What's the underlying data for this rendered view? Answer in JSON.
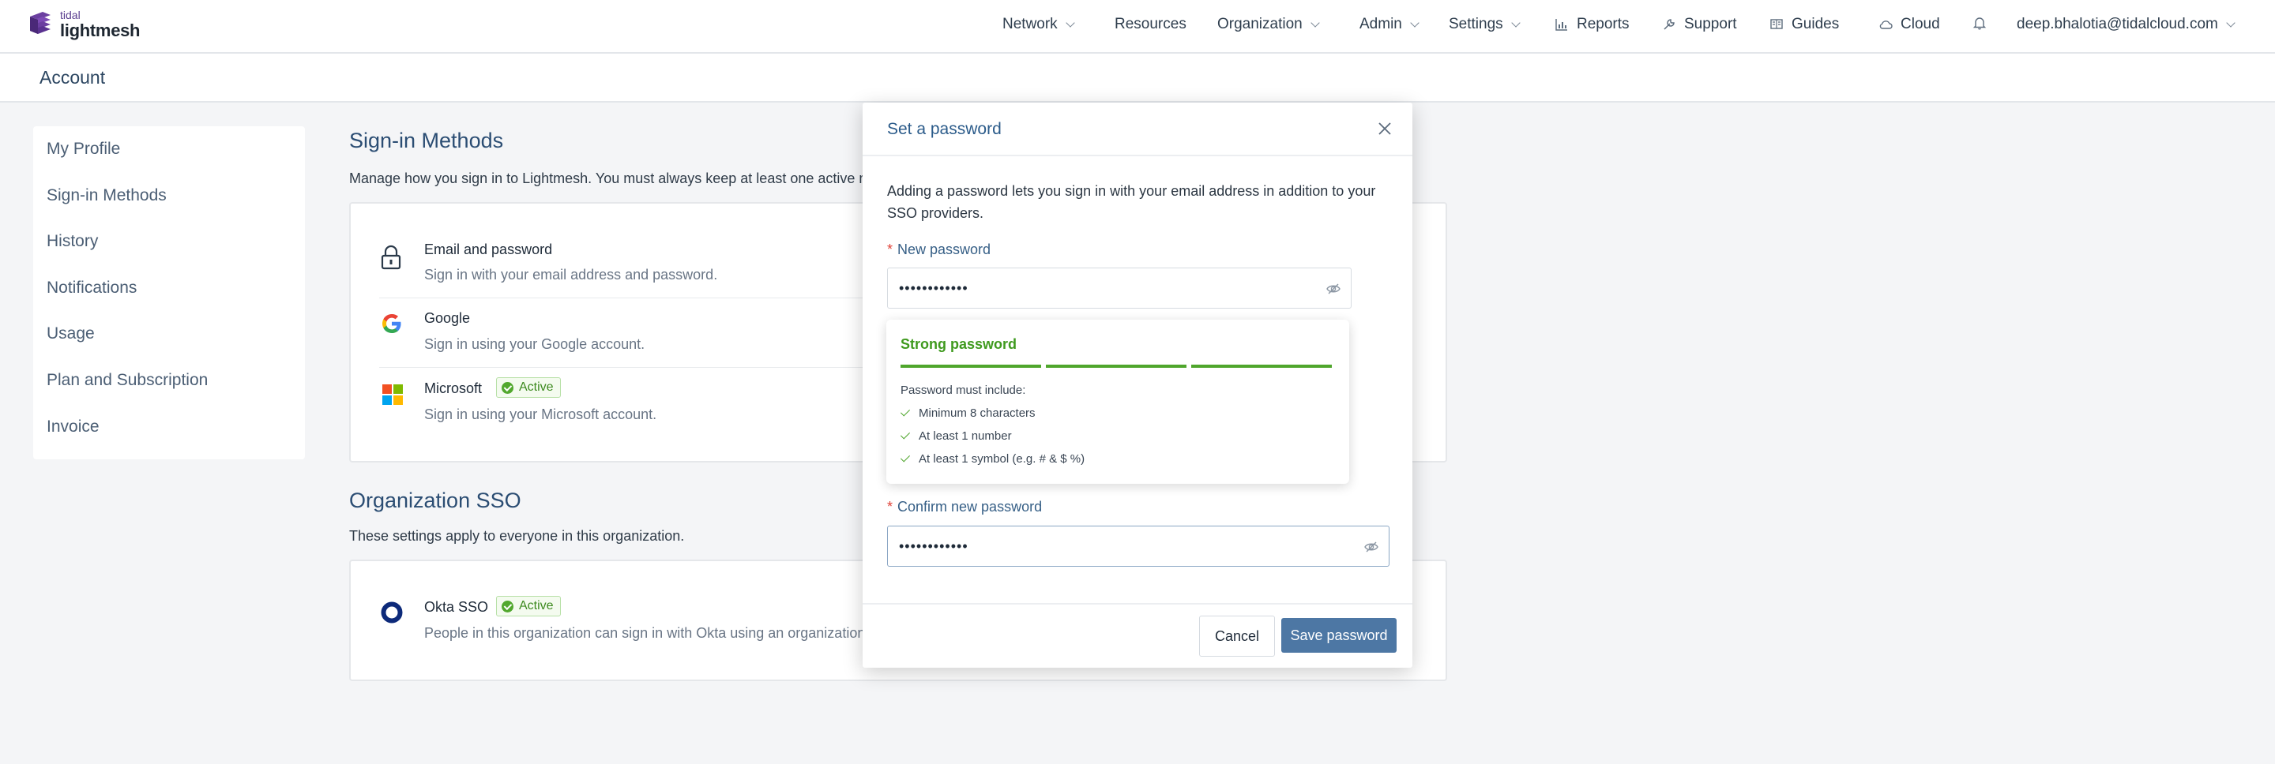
{
  "brand": {
    "small": "tidal",
    "name": "lightmesh"
  },
  "nav": {
    "network": "Network",
    "resources": "Resources",
    "organization": "Organization",
    "admin": "Admin",
    "settings": "Settings",
    "reports": "Reports",
    "support": "Support",
    "guides": "Guides",
    "cloud": "Cloud",
    "user": "deep.bhalotia@tidalcloud.com"
  },
  "page": {
    "title": "Account"
  },
  "sidebar": {
    "items": [
      {
        "label": "My Profile"
      },
      {
        "label": "Sign-in Methods"
      },
      {
        "label": "History"
      },
      {
        "label": "Notifications"
      },
      {
        "label": "Usage"
      },
      {
        "label": "Plan and Subscription"
      },
      {
        "label": "Invoice"
      }
    ]
  },
  "signin": {
    "heading": "Sign-in Methods",
    "description": "Manage how you sign in to Lightmesh. You must always keep at least one active m",
    "methods": [
      {
        "title": "Email and password",
        "subtitle": "Sign in with your email address and password.",
        "icon": "lock-icon"
      },
      {
        "title": "Google",
        "subtitle": "Sign in using your Google account.",
        "icon": "google-icon"
      },
      {
        "title": "Microsoft",
        "subtitle": "Sign in using your Microsoft account.",
        "icon": "microsoft-icon",
        "badge": "Active"
      }
    ]
  },
  "sso": {
    "heading": "Organization SSO",
    "description": "These settings apply to everyone in this organization.",
    "provider": {
      "title": "Okta SSO",
      "badge": "Active",
      "subtitle": "People in this organization can sign in with Okta using an organization",
      "icon": "okta-icon"
    }
  },
  "modal": {
    "title": "Set a password",
    "text": "Adding a password lets you sign in with your email address in addition to your SSO providers.",
    "new_label": "New password",
    "new_value": "••••••••••••",
    "confirm_label": "Confirm new password",
    "confirm_value": "••••••••••••",
    "strength": {
      "label": "Strong password",
      "segments_filled": 3,
      "segments_total": 3,
      "must_include": "Password must include:",
      "rules": [
        "Minimum 8 characters",
        "At least 1 number",
        "At least 1 symbol (e.g. # & $ %)"
      ]
    },
    "cancel": "Cancel",
    "save": "Save password"
  },
  "colors": {
    "accent": "#4d77a4",
    "heading": "#2b4d73",
    "success": "#4fa62c",
    "required": "#e0443a"
  }
}
